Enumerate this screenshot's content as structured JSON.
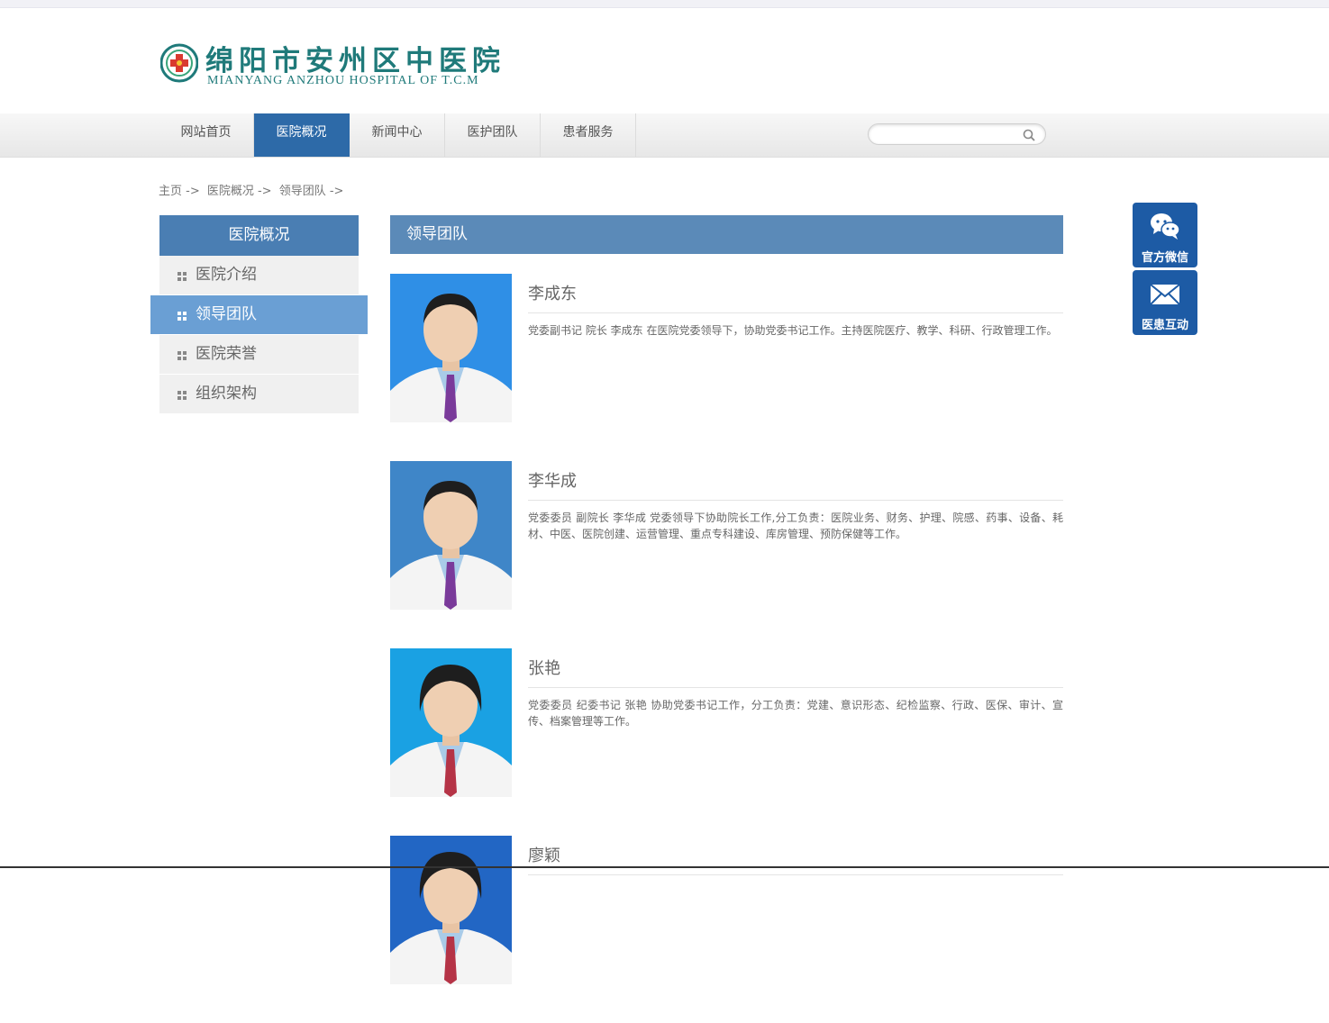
{
  "logo": {
    "name_cn": "绵阳市安州区中医院",
    "name_en": "MIANYANG ANZHOU HOSPITAL OF T.C.M"
  },
  "nav": {
    "items": [
      {
        "label": "网站首页"
      },
      {
        "label": "医院概况",
        "active": true
      },
      {
        "label": "新闻中心"
      },
      {
        "label": "医护团队"
      },
      {
        "label": "患者服务"
      }
    ],
    "search_value": ""
  },
  "breadcrumb": [
    "主页 ->",
    "医院概况 ->",
    "领导团队 ->"
  ],
  "sidebar": {
    "title": "医院概况",
    "items": [
      {
        "label": "医院介绍"
      },
      {
        "label": "领导团队",
        "active": true
      },
      {
        "label": "医院荣誉"
      },
      {
        "label": "组织架构"
      }
    ]
  },
  "content": {
    "title": "领导团队",
    "leaders": [
      {
        "name": "李成东",
        "bg": "#2f8fe6",
        "tie": "#7a3a9a",
        "desc": "党委副书记 院长 李成东 在医院党委领导下，协助党委书记工作。主持医院医疗、教学、科研、行政管理工作。"
      },
      {
        "name": "李华成",
        "bg": "#3f86c8",
        "tie": "#7a3a9a",
        "desc": "党委委员 副院长 李华成 党委领导下协助院长工作,分工负责：医院业务、财务、护理、院感、药事、设备、耗材、中医、医院创建、运营管理、重点专科建设、库房管理、预防保健等工作。"
      },
      {
        "name": "张艳",
        "bg": "#1aa1e3",
        "tie": "#b53346",
        "desc": "党委委员 纪委书记 张艳 协助党委书记工作，分工负责：党建、意识形态、纪检监察、行政、医保、审计、宣传、档案管理等工作。"
      },
      {
        "name": "廖颖",
        "bg": "#2266c4",
        "tie": "#b53346",
        "desc": ""
      }
    ]
  },
  "float": {
    "wechat_label": "官方微信",
    "message_label": "医患互动"
  },
  "colors": {
    "nav_active": "#2d6aa8",
    "sidebar_title": "#4a7eb3",
    "sidebar_active": "#6a9fd4",
    "content_title": "#5b8ab8",
    "float_button": "#1d5ba5"
  }
}
